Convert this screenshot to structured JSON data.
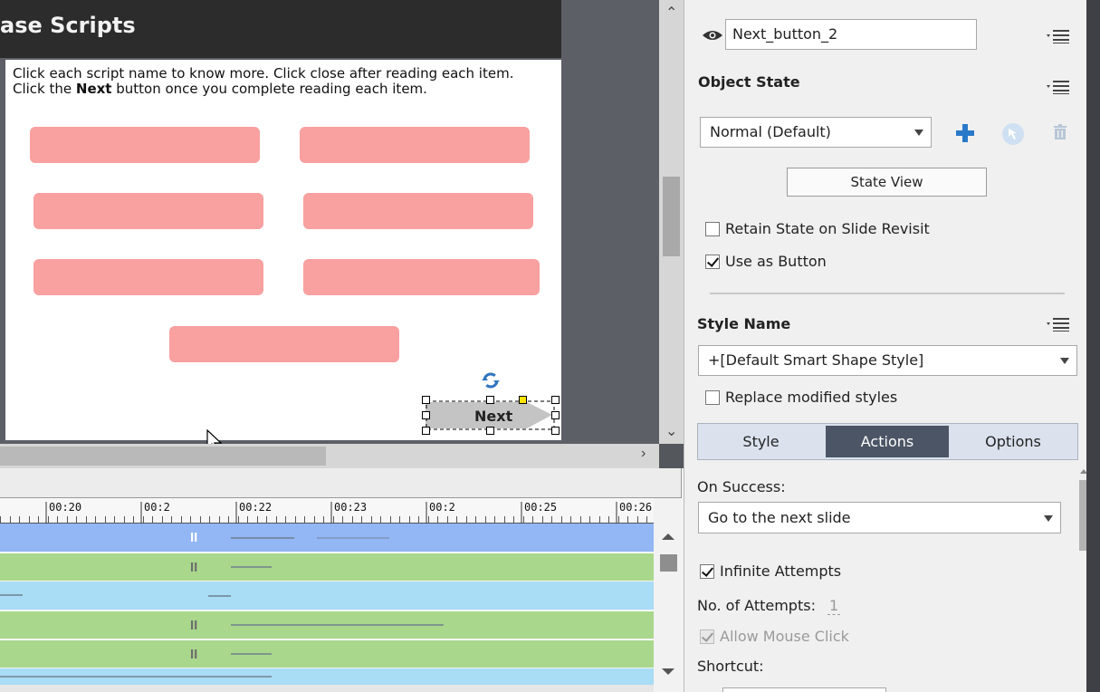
{
  "slide": {
    "title": "ase Scripts",
    "instruction_line1": "Click each script name to know more. Click close after reading each item.",
    "instruction_line2_pre": "Click the ",
    "instruction_line2_bold": "Next",
    "instruction_line2_post": " button once you complete reading each item.",
    "next_button_label": "Next"
  },
  "timeline": {
    "tick_labels": [
      "00:20",
      "00:2",
      "00:22",
      "00:23",
      "00:2",
      "00:25",
      "00:26"
    ]
  },
  "inspector": {
    "object_name": "Next_button_2",
    "object_state_heading": "Object State",
    "state_selected": "Normal (Default)",
    "state_view_button": "State View",
    "retain_state_label": "Retain State on Slide Revisit",
    "retain_state_checked": false,
    "use_as_button_label": "Use as Button",
    "use_as_button_checked": true,
    "style_name_heading": "Style Name",
    "style_selected": "+[Default Smart Shape Style]",
    "replace_styles_label": "Replace modified styles",
    "replace_styles_checked": false,
    "tabs": [
      "Style",
      "Actions",
      "Options"
    ],
    "active_tab": "Actions",
    "on_success_label": "On Success:",
    "on_success_selected": "Go to the next slide",
    "infinite_attempts_label": "Infinite Attempts",
    "infinite_attempts_checked": true,
    "attempts_label": "No. of Attempts:",
    "attempts_value": "1",
    "allow_click_label": "Allow Mouse Click",
    "allow_click_checked": true,
    "shortcut_label": "Shortcut:"
  },
  "colors": {
    "accent_plus": "#2a79c8",
    "pill": "#f9a0a0",
    "track_blue": "#93b6f4",
    "track_green": "#a9d88c",
    "active_tab": "#4b5565"
  },
  "icons": [
    "eye-icon",
    "menu-icon",
    "add-state-icon",
    "reset-state-icon",
    "delete-state-icon",
    "rotate-icon",
    "pause-icon",
    "cursor-icon"
  ]
}
